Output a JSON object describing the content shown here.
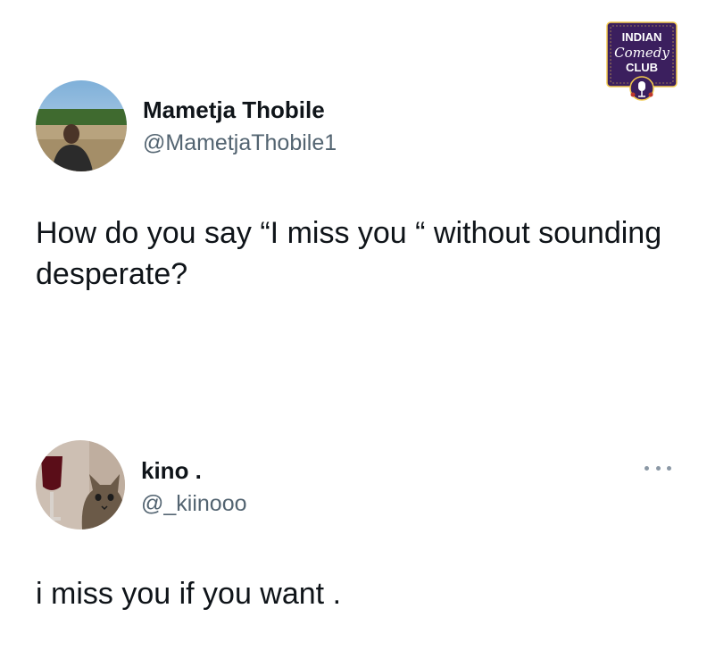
{
  "logo": {
    "line1": "INDIAN",
    "line2": "Comedy",
    "line3": "CLUB",
    "colors": {
      "background": "#3b1f5e",
      "accent": "#f2c94c",
      "text": "#ffffff"
    }
  },
  "tweet": {
    "author": {
      "name": "Mametja Thobile",
      "handle": "@MametjaThobile1"
    },
    "text": "How do you say “I miss you “ without sounding desperate?"
  },
  "reply": {
    "author": {
      "name": "kino .",
      "handle": "@_kiinooo"
    },
    "text": "i miss you if you want .",
    "more_icon": "more-horizontal-icon"
  },
  "colors": {
    "text_primary": "#0f1419",
    "text_secondary": "#536471",
    "background": "#ffffff"
  }
}
